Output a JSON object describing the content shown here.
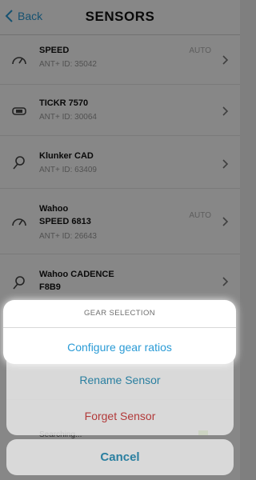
{
  "nav": {
    "back_label": "Back",
    "title": "SENSORS"
  },
  "sensors": [
    {
      "name": "SPEED",
      "sub": "ANT+ ID: 35042",
      "auto": "AUTO",
      "icon": "speedometer-icon"
    },
    {
      "name": "TICKR 7570",
      "sub": "ANT+ ID: 30064",
      "auto": "",
      "icon": "heart-strap-icon"
    },
    {
      "name": "Klunker CAD",
      "sub": "ANT+ ID: 63409",
      "auto": "",
      "icon": "cadence-icon"
    },
    {
      "name": "Wahoo",
      "name2": "SPEED 6813",
      "sub": "ANT+ ID: 26643",
      "auto": "AUTO",
      "icon": "speedometer-icon"
    },
    {
      "name": "Wahoo CADENCE",
      "name2": "F8B9",
      "sub": "",
      "auto": "",
      "icon": "cadence-icon"
    }
  ],
  "searching_label": "Searching...",
  "sheet": {
    "header": "GEAR SELECTION",
    "configure": "Configure gear ratios",
    "rename": "Rename Sensor",
    "forget": "Forget Sensor",
    "cancel": "Cancel"
  },
  "colors": {
    "accent": "#2a9bd6",
    "sheet_action": "#2a7fa0",
    "destructive": "#b23a3a",
    "overlay": "rgba(0,0,0,0.47)"
  }
}
